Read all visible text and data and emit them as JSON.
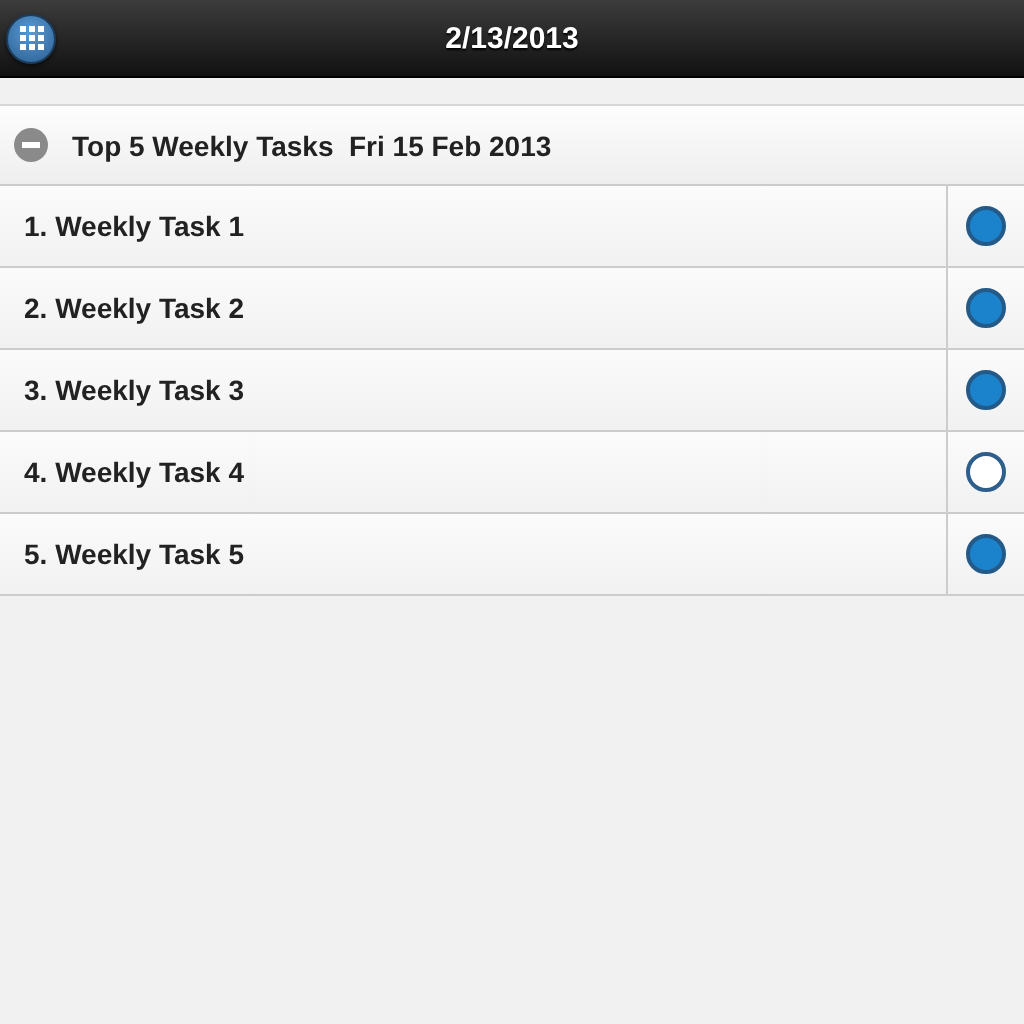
{
  "header": {
    "title": "2/13/2013"
  },
  "section": {
    "title": "Top 5 Weekly Tasks  Fri 15 Feb 2013",
    "expanded": true
  },
  "tasks": [
    {
      "label": "1. Weekly Task 1",
      "checked": true
    },
    {
      "label": "2. Weekly Task 2",
      "checked": true
    },
    {
      "label": "3. Weekly Task 3",
      "checked": true
    },
    {
      "label": "4. Weekly Task 4",
      "checked": false
    },
    {
      "label": "5. Weekly Task 5",
      "checked": true
    }
  ]
}
